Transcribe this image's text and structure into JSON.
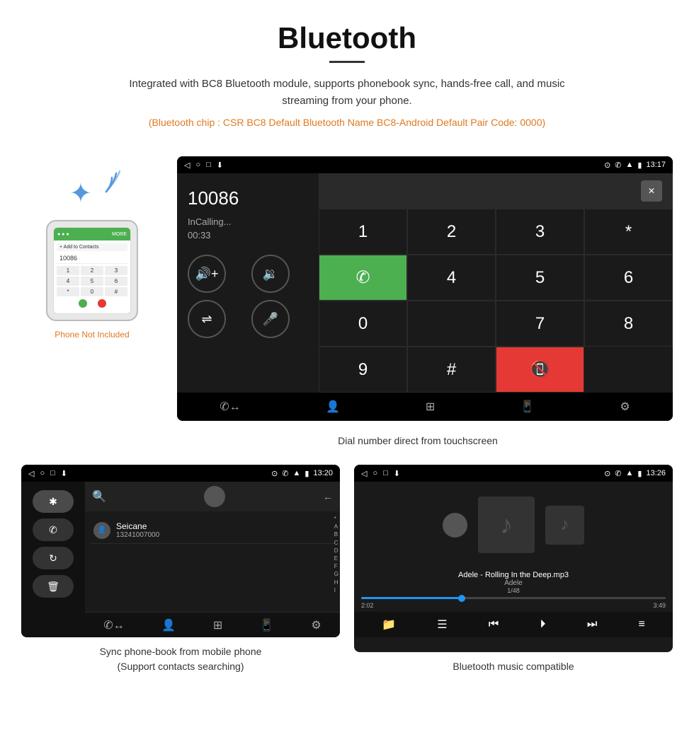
{
  "page": {
    "title": "Bluetooth",
    "underline": true,
    "description": "Integrated with BC8 Bluetooth module, supports phonebook sync, hands-free call, and music streaming from your phone.",
    "bluetooth_info": "(Bluetooth chip : CSR BC8    Default Bluetooth Name BC8-Android    Default Pair Code: 0000)"
  },
  "dial_screen": {
    "status_time": "13:17",
    "number": "10086",
    "calling_label": "InCalling...",
    "timer": "00:33",
    "keys": [
      "1",
      "2",
      "3",
      "*",
      "4",
      "5",
      "6",
      "0",
      "7",
      "8",
      "9",
      "#"
    ],
    "caption": "Dial number direct from touchscreen"
  },
  "phonebook_screen": {
    "contact_name": "Seicane",
    "contact_number": "13241007000",
    "status_time": "13:20",
    "alpha": [
      "*",
      "A",
      "B",
      "C",
      "D",
      "E",
      "F",
      "G",
      "H",
      "I"
    ],
    "caption": "Sync phone-book from mobile phone\n(Support contacts searching)"
  },
  "music_screen": {
    "status_time": "13:26",
    "song_title": "Adele - Rolling In the Deep.mp3",
    "artist": "Adele",
    "track_count": "1/48",
    "time_current": "2:02",
    "time_total": "3:49",
    "progress_percent": 33,
    "caption": "Bluetooth music compatible"
  },
  "phone_not_included": "Phone Not Included",
  "icons": {
    "bluetooth": "⚡",
    "back": "◁",
    "home": "○",
    "square": "□",
    "download": "⬇",
    "location": "⊙",
    "phone": "✆",
    "signal": "▲",
    "wifi": "▲",
    "battery": "▮",
    "volume_up": "🔊",
    "volume_down": "🔉",
    "transfer": "⇌",
    "mic": "🎤",
    "contacts": "👤",
    "dialpad": "⊞",
    "device": "📱",
    "settings": "⚙",
    "search": "🔍",
    "shuffle": "⇄",
    "prev": "⏮",
    "play": "⏵",
    "next": "⏭",
    "equalizer": "≡",
    "folder": "📁",
    "list": "☰"
  }
}
